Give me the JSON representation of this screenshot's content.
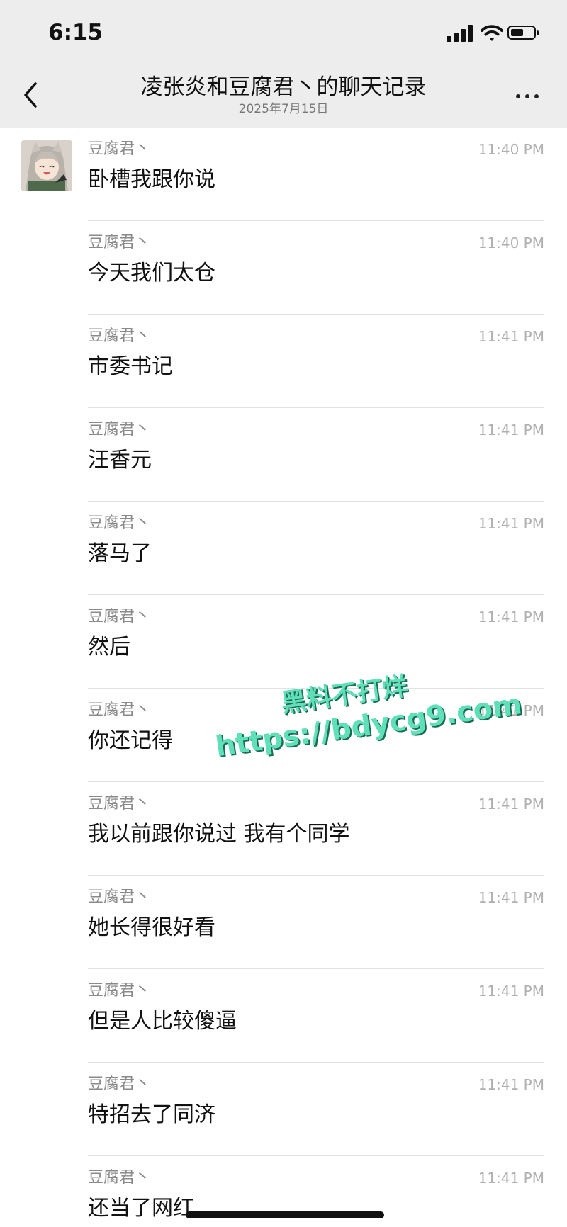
{
  "status_bar": {
    "time": "6:15"
  },
  "nav": {
    "title": "凌张炎和豆腐君丶的聊天记录",
    "subtitle": "2025年7月15日"
  },
  "messages": [
    {
      "sender": "豆腐君丶",
      "time": "11:40 PM",
      "text": "卧槽我跟你说"
    },
    {
      "sender": "豆腐君丶",
      "time": "11:40 PM",
      "text": "今天我们太仓"
    },
    {
      "sender": "豆腐君丶",
      "time": "11:41 PM",
      "text": "市委书记"
    },
    {
      "sender": "豆腐君丶",
      "time": "11:41 PM",
      "text": "汪香元"
    },
    {
      "sender": "豆腐君丶",
      "time": "11:41 PM",
      "text": "落马了"
    },
    {
      "sender": "豆腐君丶",
      "time": "11:41 PM",
      "text": "然后"
    },
    {
      "sender": "豆腐君丶",
      "time": "11:41 PM",
      "text": "你还记得"
    },
    {
      "sender": "豆腐君丶",
      "time": "11:41 PM",
      "text": "我以前跟你说过 我有个同学"
    },
    {
      "sender": "豆腐君丶",
      "time": "11:41 PM",
      "text": "她长得很好看"
    },
    {
      "sender": "豆腐君丶",
      "time": "11:41 PM",
      "text": "但是人比较傻逼"
    },
    {
      "sender": "豆腐君丶",
      "time": "11:41 PM",
      "text": "特招去了同济"
    },
    {
      "sender": "豆腐君丶",
      "time": "11:41 PM",
      "text": "还当了网红"
    }
  ],
  "watermark": {
    "line1": "黑料不打烊",
    "line2": "https://bdycg9.com"
  },
  "colors": {
    "header_bg": "#ededed",
    "watermark": "#5fe0b8",
    "divider": "#e2e2e2"
  },
  "icons": {
    "back": "chevron-left-icon",
    "more": "more-dots-icon",
    "signal": "signal-icon",
    "wifi": "wifi-icon",
    "battery": "battery-icon"
  }
}
